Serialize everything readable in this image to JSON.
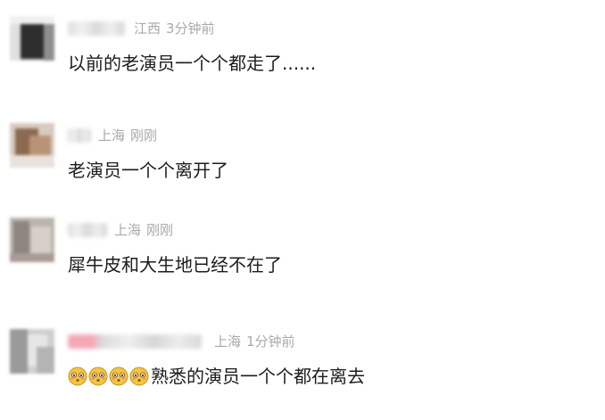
{
  "comments": [
    {
      "location": "江西",
      "time": "3分钟前",
      "text": "以前的老演员一个个都走了......"
    },
    {
      "location": "上海",
      "time": "刚刚",
      "text": "老演员一个个离开了"
    },
    {
      "location": "上海",
      "time": "刚刚",
      "text": "犀牛皮和大生地已经不在了"
    },
    {
      "location": "上海",
      "time": "1分钟前",
      "emoji": [
        "flushed-face-icon",
        "flushed-face-icon",
        "flushed-face-icon",
        "flushed-face-icon"
      ],
      "text": "熟悉的演员一个个都在离去"
    }
  ],
  "colors": {
    "meta_text": "#a9a9a9",
    "comment_text": "#1c1c1c",
    "emoji_face": "#f5c542"
  }
}
